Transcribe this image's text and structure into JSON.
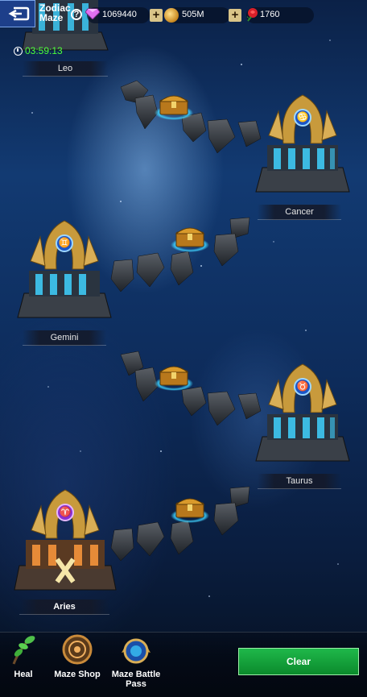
{
  "header": {
    "title": "Zodiac Maze",
    "gems": "1069440",
    "coins": "505M",
    "roses": "1760"
  },
  "timer": "03:59:13",
  "platforms": [
    {
      "name": "Leo"
    },
    {
      "name": "Cancer",
      "symbol": "♋"
    },
    {
      "name": "Gemini",
      "symbol": "♊"
    },
    {
      "name": "Taurus",
      "symbol": "♉"
    },
    {
      "name": "Aries",
      "symbol": "♈"
    }
  ],
  "bottom": {
    "heal": "Heal",
    "shop": "Maze Shop",
    "pass": "Maze Battle Pass",
    "clear": "Clear"
  },
  "colors": {
    "timer": "#4cff3a",
    "clear_button": "#14a53c",
    "platform_glow": "#3fd2ff"
  }
}
